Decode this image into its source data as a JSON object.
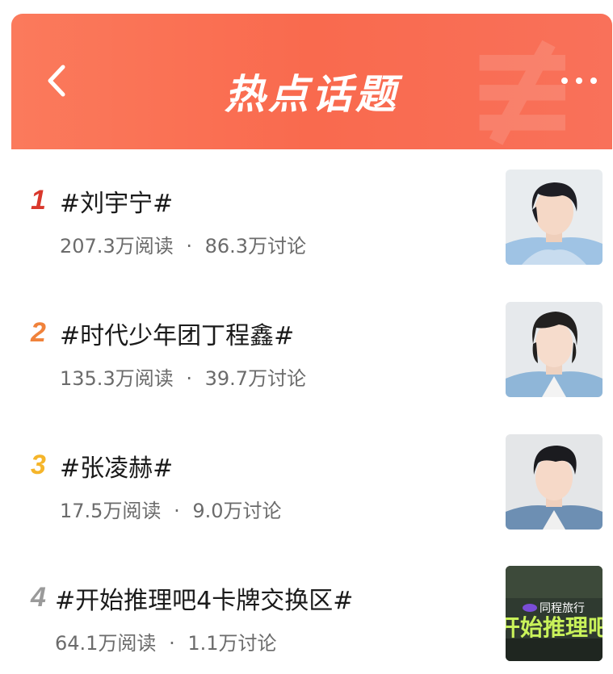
{
  "header": {
    "title": "热点话题",
    "back_icon": "chevron-left-icon",
    "more_icon": "more-horizontal-icon",
    "gradient_start": "#fb7a5c",
    "gradient_end": "#f9715a"
  },
  "topics": [
    {
      "rank": "1",
      "rank_color": "#d9382c",
      "title": "#刘宇宁#",
      "reads": "207.3万阅读",
      "separator": "·",
      "discussions": "86.3万讨论"
    },
    {
      "rank": "2",
      "rank_color": "#f0823b",
      "title": "#时代少年团丁程鑫#",
      "reads": "135.3万阅读",
      "separator": "·",
      "discussions": "39.7万讨论"
    },
    {
      "rank": "3",
      "rank_color": "#f5b52a",
      "title": "#张凌赫#",
      "reads": "17.5万阅读",
      "separator": "·",
      "discussions": "9.0万讨论"
    },
    {
      "rank": "4",
      "rank_color": "#9a9a9a",
      "title": "#开始推理吧4卡牌交换区#",
      "reads": "64.1万阅读",
      "separator": "·",
      "discussions": "1.1万讨论"
    }
  ],
  "promo_thumb": {
    "line1": "同程旅行",
    "line2": "开始推理吧"
  }
}
